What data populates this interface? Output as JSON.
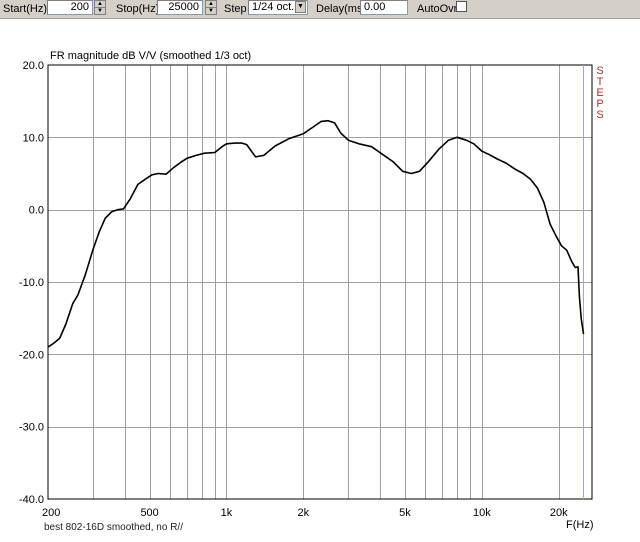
{
  "toolbar": {
    "start_label": "Start(Hz)",
    "start_value": "200",
    "stop_label": "Stop(Hz)",
    "stop_value": "25000",
    "step_label": "Step",
    "step_value": "1/24 oct.",
    "delay_label": "Delay(ms)",
    "delay_value": "0.00",
    "autoovr_label": "AutoOvr"
  },
  "side_label": "STEPS",
  "footer_text": "best 802-16D smoothed, no R//",
  "colors": {
    "curve": "#000000",
    "marker": "#d4b020",
    "grid": "#a0a0a0"
  },
  "chart_data": {
    "type": "line",
    "title": "FR magnitude dB V/V (smoothed  1/3 oct)",
    "xlabel": "F(Hz)",
    "ylabel": "",
    "x_scale": "log",
    "xlim": [
      200,
      27000
    ],
    "ylim": [
      -40,
      20
    ],
    "yticks": [
      20,
      10,
      0,
      -10,
      -20,
      -30,
      -40
    ],
    "ytick_labels": [
      "20.0",
      "10.0",
      "0.0",
      "-10.0",
      "-20.0",
      "-30.0",
      "-40.0"
    ],
    "xticks": [
      200,
      500,
      1000,
      2000,
      5000,
      10000,
      20000
    ],
    "xtick_labels": [
      "200",
      "500",
      "1k",
      "2k",
      "5k",
      "10k",
      "20k"
    ],
    "grid": true,
    "marker_x": 25000,
    "series": [
      {
        "x": [
          200,
          210,
          222,
          235,
          250,
          262,
          280,
          300,
          318,
          335,
          355,
          375,
          395,
          420,
          450,
          480,
          510,
          540,
          580,
          620,
          660,
          700,
          760,
          820,
          900,
          960,
          1000,
          1080,
          1150,
          1200,
          1300,
          1400,
          1550,
          1750,
          2000,
          2200,
          2350,
          2500,
          2650,
          2800,
          3000,
          3300,
          3700,
          4100,
          4500,
          4900,
          5300,
          5700,
          6200,
          6800,
          7400,
          8000,
          8700,
          9300,
          10000,
          10700,
          11500,
          12500,
          13500,
          14500,
          15500,
          16500,
          17500,
          18500,
          19500,
          20500,
          21500,
          22500,
          23200,
          23800,
          24100,
          24500,
          25000
        ],
        "y": [
          -19.0,
          -18.5,
          -17.8,
          -15.8,
          -13.0,
          -11.8,
          -9.0,
          -5.5,
          -3.0,
          -1.2,
          -0.3,
          0.0,
          0.1,
          1.5,
          3.5,
          4.2,
          4.8,
          5.0,
          4.9,
          5.8,
          6.5,
          7.1,
          7.5,
          7.8,
          7.9,
          8.7,
          9.1,
          9.2,
          9.2,
          9.0,
          7.3,
          7.5,
          8.8,
          9.8,
          10.5,
          11.5,
          12.2,
          12.3,
          12.0,
          10.6,
          9.6,
          9.1,
          8.7,
          7.6,
          6.6,
          5.3,
          5.0,
          5.3,
          6.7,
          8.4,
          9.6,
          10.0,
          9.6,
          9.1,
          8.1,
          7.6,
          7.0,
          6.4,
          5.6,
          5.0,
          4.2,
          3.0,
          1.0,
          -2.0,
          -3.6,
          -5.0,
          -5.6,
          -7.2,
          -8.0,
          -7.9,
          -12.0,
          -15.0,
          -17.2
        ]
      }
    ]
  }
}
